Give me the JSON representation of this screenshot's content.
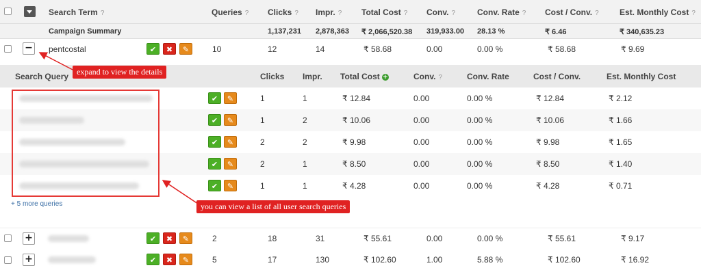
{
  "header": {
    "search_term": "Search Term",
    "queries": "Queries",
    "clicks": "Clicks",
    "impr": "Impr.",
    "total_cost": "Total Cost",
    "conv": "Conv.",
    "conv_rate": "Conv. Rate",
    "cost_conv": "Cost / Conv.",
    "est_monthly": "Est. Monthly Cost",
    "help": "?"
  },
  "summary": {
    "label": "Campaign Summary",
    "clicks": "1,137,231",
    "impr": "2,878,363",
    "total_cost": "₹ 2,066,520.38",
    "conv": "319,933.00",
    "conv_rate": "28.13 %",
    "cost_conv": "₹ 6.46",
    "est_monthly": "₹ 340,635.23"
  },
  "icons": {
    "check": "✔",
    "cross": "✖",
    "pencil": "✎",
    "minus": "−",
    "plus": "+"
  },
  "rows": [
    {
      "term": "pentcostal",
      "queries": "10",
      "clicks": "12",
      "impr": "14",
      "total_cost": "₹ 58.68",
      "conv": "0.00",
      "conv_rate": "0.00 %",
      "cost_conv": "₹ 58.68",
      "est_monthly": "₹ 9.69"
    },
    {
      "term": "",
      "queries": "2",
      "clicks": "18",
      "impr": "31",
      "total_cost": "₹ 55.61",
      "conv": "0.00",
      "conv_rate": "0.00 %",
      "cost_conv": "₹ 55.61",
      "est_monthly": "₹ 9.17"
    },
    {
      "term": "",
      "queries": "5",
      "clicks": "17",
      "impr": "130",
      "total_cost": "₹ 102.60",
      "conv": "1.00",
      "conv_rate": "5.88 %",
      "cost_conv": "₹ 102.60",
      "est_monthly": "₹ 16.92"
    }
  ],
  "sub": {
    "header": {
      "search_query": "Search Query",
      "clicks": "Clicks",
      "impr": "Impr.",
      "total_cost": "Total Cost",
      "conv": "Conv.",
      "conv_rate": "Conv. Rate",
      "cost_conv": "Cost / Conv.",
      "est_monthly": "Est. Monthly Cost"
    },
    "rows": [
      {
        "clicks": "1",
        "impr": "1",
        "total_cost": "₹ 12.84",
        "conv": "0.00",
        "conv_rate": "0.00 %",
        "cost_conv": "₹ 12.84",
        "est_monthly": "₹ 2.12"
      },
      {
        "clicks": "1",
        "impr": "2",
        "total_cost": "₹ 10.06",
        "conv": "0.00",
        "conv_rate": "0.00 %",
        "cost_conv": "₹ 10.06",
        "est_monthly": "₹ 1.66"
      },
      {
        "clicks": "2",
        "impr": "2",
        "total_cost": "₹ 9.98",
        "conv": "0.00",
        "conv_rate": "0.00 %",
        "cost_conv": "₹ 9.98",
        "est_monthly": "₹ 1.65"
      },
      {
        "clicks": "2",
        "impr": "1",
        "total_cost": "₹ 8.50",
        "conv": "0.00",
        "conv_rate": "0.00 %",
        "cost_conv": "₹ 8.50",
        "est_monthly": "₹ 1.40"
      },
      {
        "clicks": "1",
        "impr": "1",
        "total_cost": "₹ 4.28",
        "conv": "0.00",
        "conv_rate": "0.00 %",
        "cost_conv": "₹ 4.28",
        "est_monthly": "₹ 0.71"
      }
    ],
    "more_link": "+ 5 more queries"
  },
  "annotations": {
    "expand": "expand to view the details",
    "list": "you can view a list of all user search queries"
  },
  "colors": {
    "ok": "#4caf26",
    "cross": "#d9261c",
    "edit": "#e68a1c",
    "note": "#e02222",
    "link": "#3a6ea5"
  }
}
